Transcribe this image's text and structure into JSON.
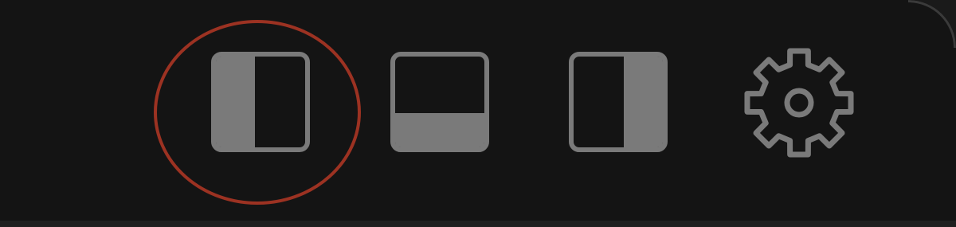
{
  "toolbar": {
    "buttons": [
      {
        "id": "toggle-left-sidebar",
        "icon": "layout-sidebar-left-icon",
        "active": true
      },
      {
        "id": "toggle-bottom-panel",
        "icon": "layout-panel-bottom-icon",
        "active": true
      },
      {
        "id": "toggle-right-sidebar",
        "icon": "layout-sidebar-right-icon",
        "active": true
      },
      {
        "id": "settings",
        "icon": "gear-icon"
      }
    ],
    "highlighted_button": "toggle-left-sidebar"
  },
  "colors": {
    "background": "#141414",
    "icon": "#7a7a7a",
    "highlight": "#9c3222"
  }
}
